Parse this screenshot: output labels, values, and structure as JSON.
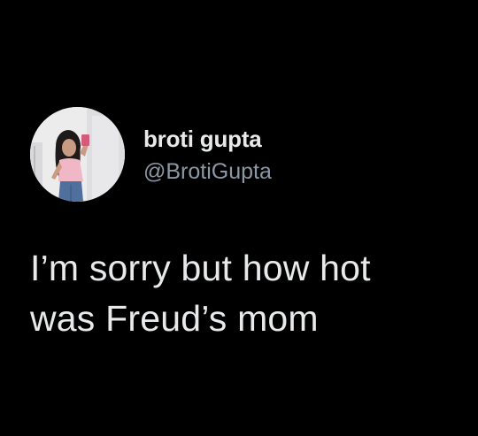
{
  "tweet": {
    "author": {
      "display_name": "broti gupta",
      "handle": "@BrotiGupta",
      "avatar_icon": "profile-photo"
    },
    "text_lines": [
      "I’m sorry but how hot",
      "was Freud’s mom"
    ]
  },
  "colors": {
    "background": "#000000",
    "primary_text": "#e7e9ea",
    "secondary_text": "#8b98a5"
  }
}
